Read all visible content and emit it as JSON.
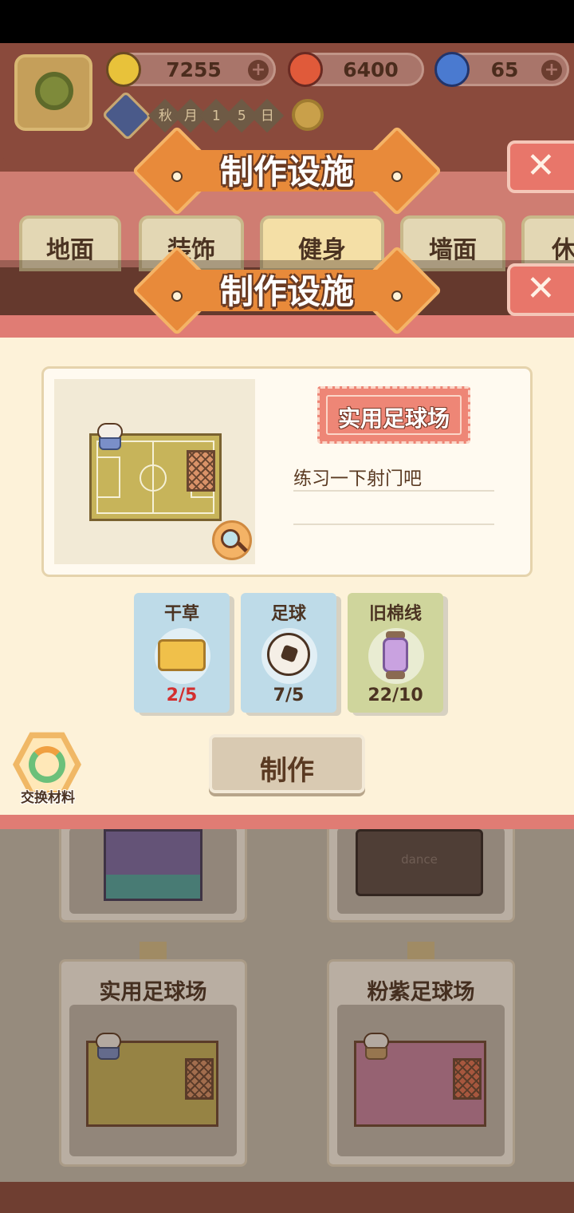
{
  "hud": {
    "bananas": "7255",
    "fire_bananas": "6400",
    "blue_bananas": "65",
    "plus_symbol": "+",
    "date_chars": [
      "秋",
      "月",
      "1",
      "5",
      "日"
    ]
  },
  "background_panel": {
    "title": "制作设施",
    "close_symbol": "✕",
    "tabs": [
      "地面",
      "装饰",
      "健身",
      "墙面",
      "休"
    ]
  },
  "modal": {
    "title": "制作设施",
    "close_symbol": "✕",
    "item_name": "实用足球场",
    "description": "练习一下射门吧",
    "materials": [
      {
        "name": "干草",
        "count": "2/5",
        "icon": "hay-icon",
        "sufficient": false
      },
      {
        "name": "足球",
        "count": "7/5",
        "icon": "soccer-ball-icon",
        "sufficient": true
      },
      {
        "name": "旧棉线",
        "count": "22/10",
        "icon": "cotton-spool-icon",
        "sufficient": true
      }
    ],
    "make_label": "制作",
    "swap_label": "交换材料"
  },
  "catalogue": {
    "items": [
      {
        "name": "实用足球场"
      },
      {
        "name": "粉紫足球场"
      }
    ],
    "dance_text": "dance"
  },
  "colors": {
    "insufficient": "#d32f2f",
    "sufficient": "#4b3322",
    "accent_orange": "#e88a3a",
    "modal_band": "#e07c74"
  }
}
